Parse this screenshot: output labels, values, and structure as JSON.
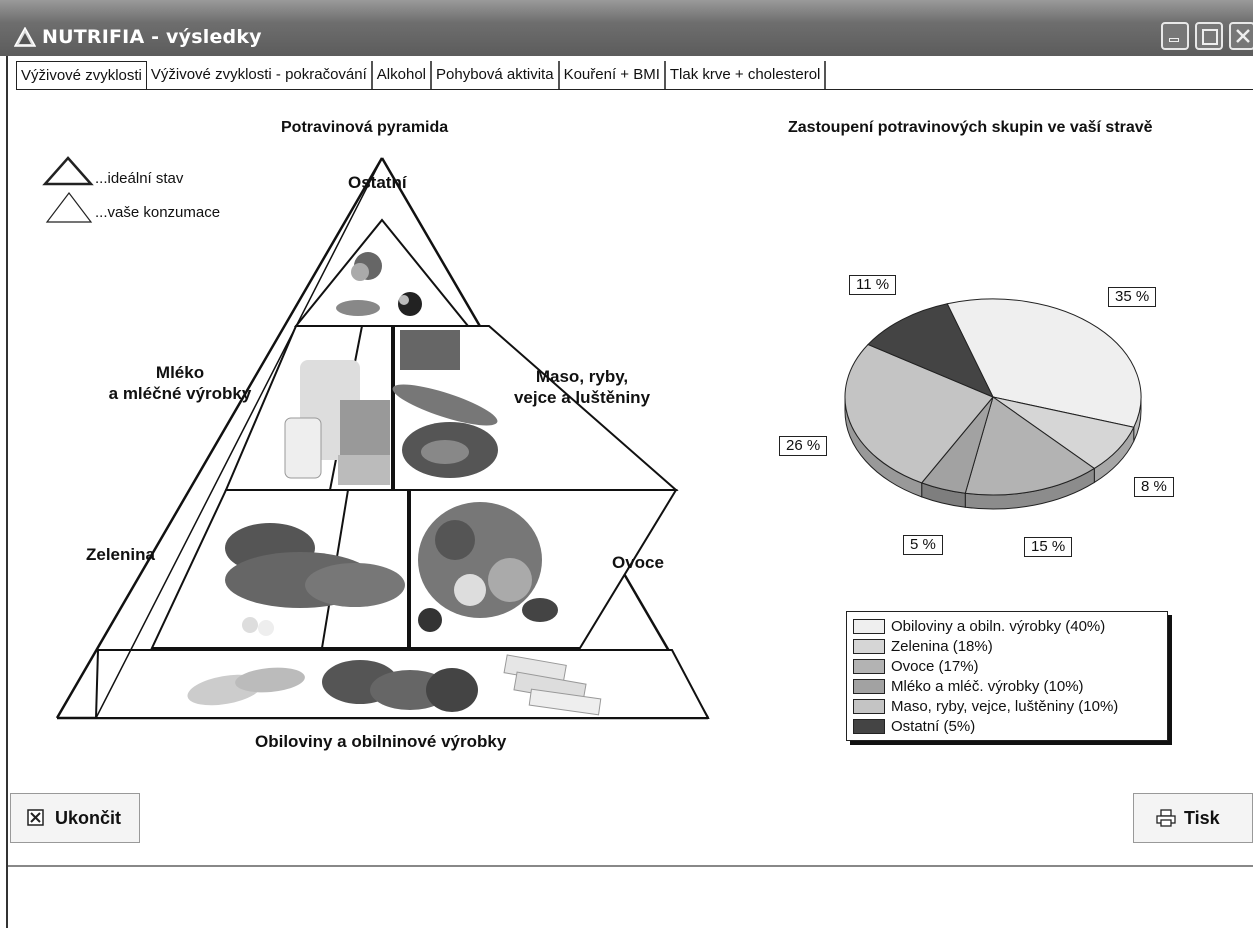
{
  "window": {
    "title": "NUTRIFIA - výsledky"
  },
  "tabs": [
    {
      "label": "Výživové zvyklosti"
    },
    {
      "label": "Výživové zvyklosti - pokračování"
    },
    {
      "label": "Alkohol"
    },
    {
      "label": "Pohybová aktivita"
    },
    {
      "label": "Kouření + BMI"
    },
    {
      "label": "Tlak krve + cholesterol"
    }
  ],
  "active_tab": 0,
  "pyramid": {
    "title": "Potravinová pyramida",
    "legend": {
      "ideal": "...ideální stav",
      "yours": "...vaše konzumace"
    },
    "labels": {
      "ostatni": "Ostatní",
      "mleko": [
        "Mléko",
        "a mléčné výrobky"
      ],
      "maso": [
        "Maso, ryby,",
        "vejce a luštěniny"
      ],
      "zelenina": "Zelenina",
      "ovoce": "Ovoce",
      "obiloviny": "Obiloviny a obilninové výrobky"
    }
  },
  "pie_title": "Zastoupení potravinových skupin ve vaší stravě",
  "chart_data": {
    "type": "pie",
    "title": "Zastoupení potravinových skupin ve vaší stravě",
    "slices": [
      {
        "legend": "Obiloviny a obiln. výrobky (40%)",
        "label": "35 %",
        "value": 35,
        "color": "#efefef"
      },
      {
        "legend": "Zelenina (18%)",
        "label": "8 %",
        "value": 8,
        "color": "#d6d6d6"
      },
      {
        "legend": "Ovoce (17%)",
        "label": "15 %",
        "value": 15,
        "color": "#b3b3b3"
      },
      {
        "legend": "Mléko a mléč. výrobky (10%)",
        "label": "5 %",
        "value": 5,
        "color": "#a2a2a2"
      },
      {
        "legend": "Maso, ryby, vejce, luštěniny (10%)",
        "label": "26 %",
        "value": 26,
        "color": "#c4c4c4"
      },
      {
        "legend": "Ostatní (5%)",
        "label": "11 %",
        "value": 11,
        "color": "#444444"
      }
    ]
  },
  "buttons": {
    "quit": "Ukončit",
    "print": "Tisk"
  }
}
